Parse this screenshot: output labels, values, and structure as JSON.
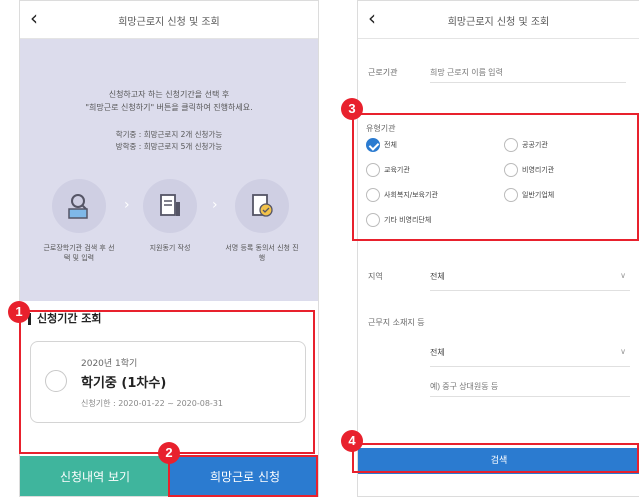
{
  "left": {
    "title": "희망근로지 신청 및 조회",
    "hero": {
      "line1": "신청하고자 하는 신청기간을 선택 후",
      "line2": "\"희망근로 신청하기\" 버튼을 클릭하여 진행하세요.",
      "line3": "학기중 : 희망근로지 2개 신청가능",
      "line4": "방학중 : 희망근로지 5개 신청가능"
    },
    "steps": [
      {
        "caption": "근로장학기관 검색 후 선택 및 입력",
        "icon": "institution-search-icon"
      },
      {
        "caption": "지원동기 작성",
        "icon": "document-edit-icon"
      },
      {
        "caption": "서명 등록 동의서 신청 진행",
        "icon": "signature-document-icon"
      }
    ],
    "section_title": "신청기간 조회",
    "period": {
      "semester": "2020년 1학기",
      "status": "학기중 (1차수)",
      "range": "신청기한 : 2020-01-22 ~ 2020-08-31"
    },
    "buttons": {
      "history": "신청내역 보기",
      "apply": "희망근로 신청"
    }
  },
  "right": {
    "title": "희망근로지 신청 및 조회",
    "workplace_label": "근로기관",
    "workplace_placeholder": "희망 근로지 이름 입력",
    "agency_label": "유형기관",
    "agency_options": [
      {
        "label": "전체",
        "checked": true
      },
      {
        "label": "공공기관",
        "checked": false
      },
      {
        "label": "교육기관",
        "checked": false
      },
      {
        "label": "비영리기관",
        "checked": false
      },
      {
        "label": "사회복지/보육기관",
        "checked": false
      },
      {
        "label": "일반기업체",
        "checked": false
      },
      {
        "label": "기타 비영리단체",
        "checked": false
      }
    ],
    "region_label": "지역",
    "region_value": "전체",
    "area_label": "근무지 소재지 등",
    "area_value": "전체",
    "detail_placeholder": "예) 중구 상대원동 등",
    "search_button": "검색"
  },
  "badges": [
    "1",
    "2",
    "3",
    "4"
  ],
  "colors": {
    "accent_blue": "#2b7bd0",
    "accent_green": "#3fb59d",
    "highlight_red": "#e8212d",
    "hero_bg": "#dcdcec"
  }
}
